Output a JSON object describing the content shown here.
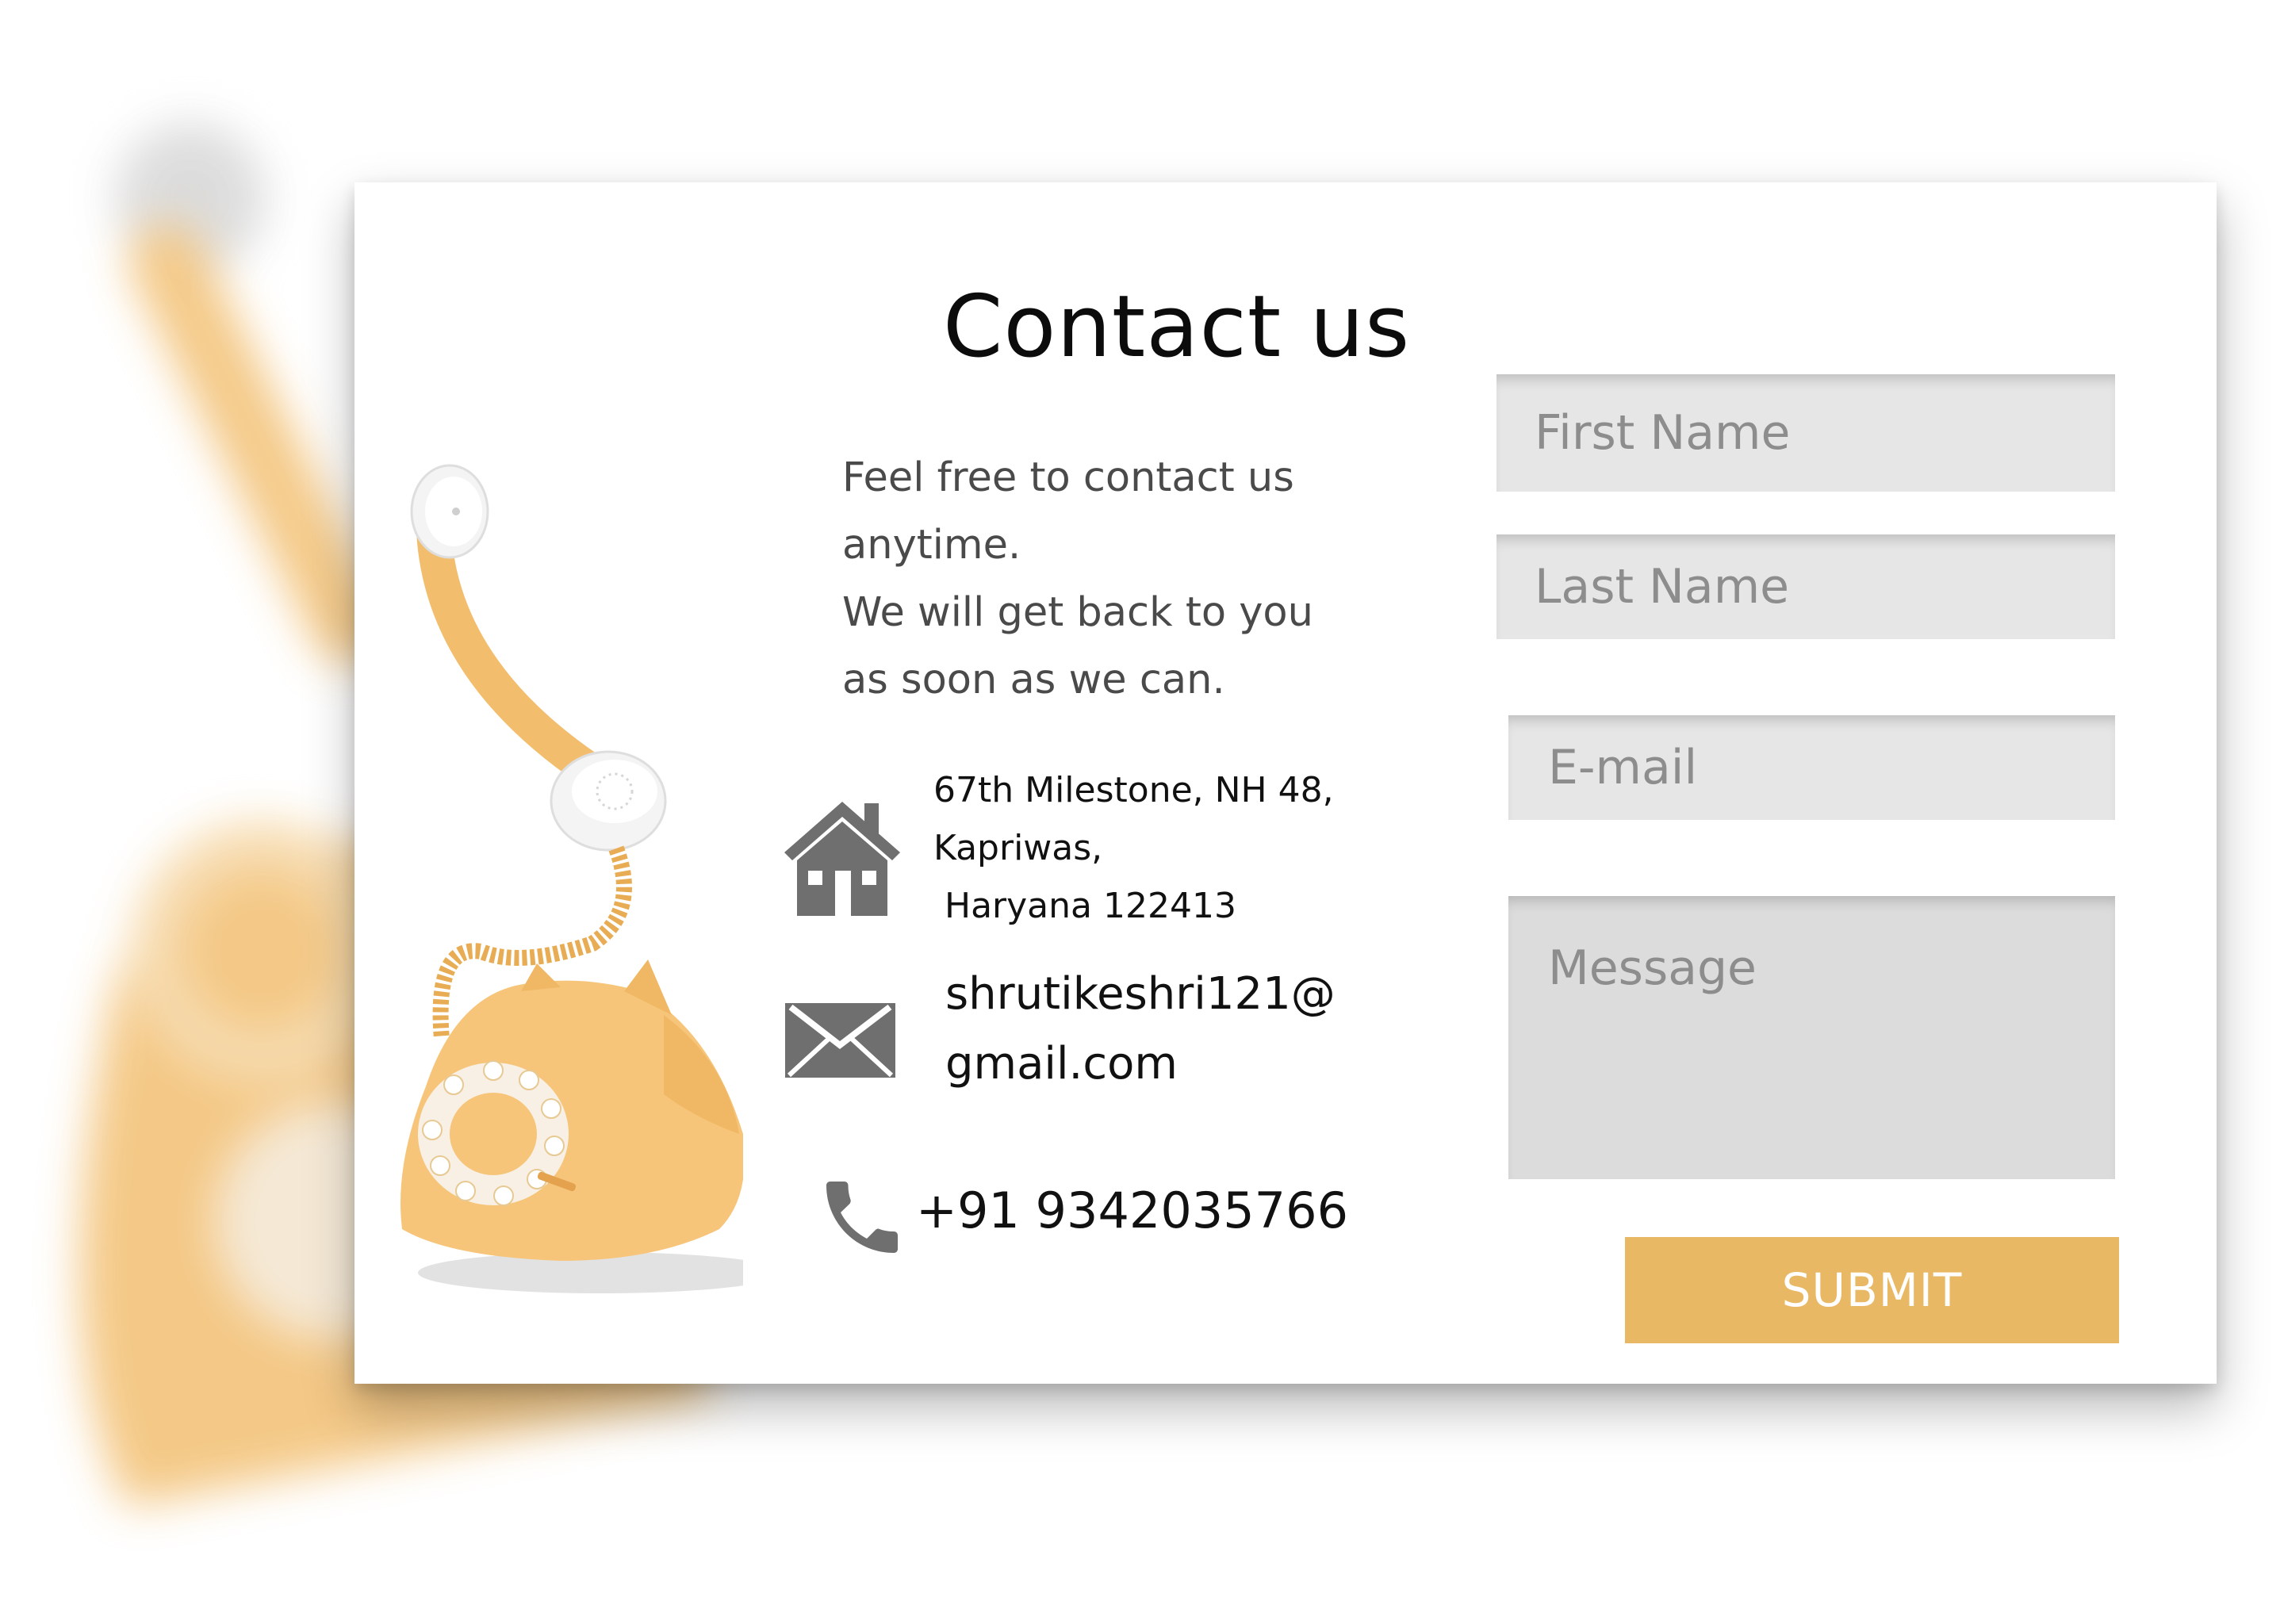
{
  "page": {
    "title": "Contact us",
    "intro_lines": [
      "Feel free to contact us",
      "anytime.",
      "We will get back to you",
      "as soon as we can."
    ]
  },
  "contact": {
    "address_lines": [
      "67th Milestone, NH 48,",
      "Kapriwas,",
      "Haryana 122413"
    ],
    "address_icon": "home-icon",
    "email_lines": [
      "shrutikeshri121@",
      "gmail.com"
    ],
    "email_icon": "envelope-icon",
    "phone": "+91 9342035766",
    "phone_icon": "phone-icon"
  },
  "form": {
    "first_name_placeholder": "First Name",
    "last_name_placeholder": "Last Name",
    "email_placeholder": "E-mail",
    "message_placeholder": "Message",
    "submit_label": "SUBMIT"
  },
  "colors": {
    "accent": "#e9b865",
    "icon_gray": "#6f6f6f",
    "field_bg": "#e6e6e6",
    "phone_body": "#f6c57a"
  }
}
